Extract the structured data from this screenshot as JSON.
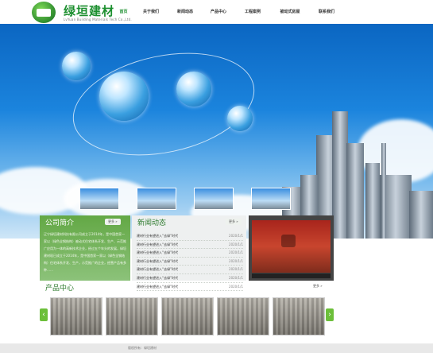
{
  "brand": {
    "name": "绿垣建材",
    "subtitle": "LvYuan Building Materials Tech Co.,Ltd."
  },
  "nav": {
    "items": [
      "首页",
      "关于我们",
      "新闻动态",
      "产品中心",
      "工程案例",
      "被动式房屋",
      "联系我们"
    ],
    "active": 0
  },
  "about": {
    "title": "公司简介",
    "more_label": "更多 »",
    "text": "辽宁绿垣建材科技有限公司成立于2014年，是中国首家一家以（绿色全钢结构）被动式住宅体系开发、生产、示范推广应用为一体的高新技术企业，经过五个年头的发展，绿垣建材现已成立于2014年，是中国首家一家以（绿色全钢结构）住宅体系开发、生产，示范推广的企业，经营产品有多种……"
  },
  "news": {
    "title": "新闻动态",
    "more_label": "更多 »",
    "rows": [
      {
        "title": "建材行业有望进入“去绿”时代",
        "date": "2020/1/1"
      },
      {
        "title": "建材行业有望进入“去绿”时代",
        "date": "2020/1/1"
      },
      {
        "title": "建材行业有望进入“去绿”时代",
        "date": "2020/1/1"
      },
      {
        "title": "建材行业有望进入“去绿”时代",
        "date": "2020/1/1"
      },
      {
        "title": "建材行业有望进入“去绿”时代",
        "date": "2020/1/1"
      },
      {
        "title": "建材行业有望进入“去绿”时代",
        "date": "2020/1/1"
      },
      {
        "title": "建材行业有望进入“去绿”时代",
        "date": "2020/1/1"
      }
    ]
  },
  "products": {
    "title": "产品中心",
    "more_label": "更多 »",
    "prev_icon": "chevron-left-icon",
    "next_icon": "chevron-right-icon"
  },
  "footer": {
    "text": "版权所有：绿垣建材"
  },
  "colors": {
    "brand_green": "#1c8f2f",
    "panel_green": "#63a845",
    "sky_blue": "#1b84dd"
  }
}
